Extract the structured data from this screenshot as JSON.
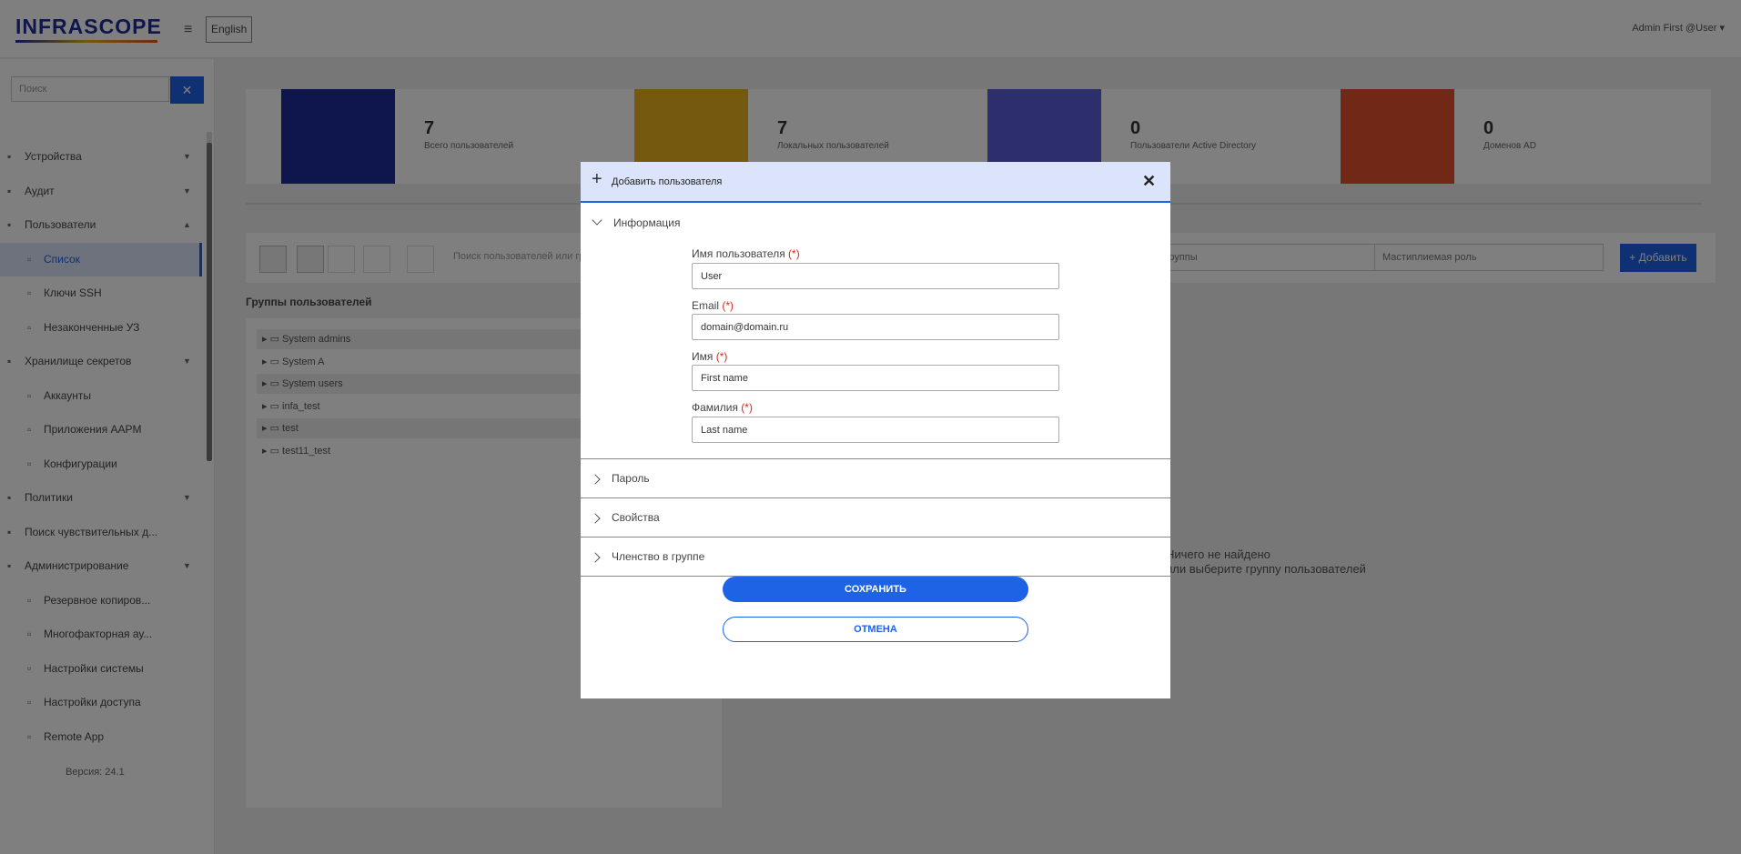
{
  "app": {
    "logo": "INFRASCOPE",
    "language": "English",
    "user_menu": "Admin First @User"
  },
  "sidebar": {
    "search_placeholder": "Поиск",
    "items": [
      {
        "label": "Устройства",
        "icon": "devices-icon",
        "level": 0
      },
      {
        "label": "Аудит",
        "icon": "audit-icon",
        "level": 0
      },
      {
        "label": "Пользователи",
        "icon": "user-icon",
        "level": 0
      },
      {
        "label": "Список",
        "icon": "list-icon",
        "level": 1,
        "active": true
      },
      {
        "label": "Ключи SSH",
        "icon": "key-icon",
        "level": 1
      },
      {
        "label": "Незаконченные УЗ",
        "icon": "pending-icon",
        "level": 1
      },
      {
        "label": "Хранилище секретов",
        "icon": "vault-icon",
        "level": 0
      },
      {
        "label": "Аккаунты",
        "icon": "accounts-icon",
        "level": 1
      },
      {
        "label": "Приложения AAPM",
        "icon": "apps-icon",
        "level": 1
      },
      {
        "label": "Конфигурации",
        "icon": "config-icon",
        "level": 1
      },
      {
        "label": "Политики",
        "icon": "policy-icon",
        "level": 0
      },
      {
        "label": "Поиск чувствительных д...",
        "icon": "search-doc-icon",
        "level": 0
      },
      {
        "label": "Администрирование",
        "icon": "admin-icon",
        "level": 0
      },
      {
        "label": "Резервное копиров...",
        "icon": "backup-icon",
        "level": 1
      },
      {
        "label": "Многофакторная ау...",
        "icon": "mfa-icon",
        "level": 1
      },
      {
        "label": "Настройки системы",
        "icon": "settings-icon",
        "level": 1
      },
      {
        "label": "Настройки доступа",
        "icon": "access-icon",
        "level": 1
      },
      {
        "label": "Remote App",
        "icon": "remote-icon",
        "level": 1
      }
    ],
    "version": "Версия: 24.1"
  },
  "stats": [
    {
      "value": "7",
      "label": "Всего пользователей",
      "color": "#1f2c9c"
    },
    {
      "value": "7",
      "label": "Локальных пользователей",
      "color": "#e8b21c"
    },
    {
      "value": "0",
      "label": "Пользователи Active Directory",
      "color": "#5b5fd9"
    },
    {
      "value": "0",
      "label": "Доменов AD",
      "color": "#e3502c"
    }
  ],
  "toolbar": {
    "search_placeholder": "Поиск пользователей или гр...",
    "filter_groups": "Группы",
    "filter_roles": "Мастиплиемая роль",
    "add_label": "Добавить"
  },
  "groups": {
    "title": "Группы пользователей",
    "items": [
      "System admins",
      "System A",
      "System users",
      "infa_test",
      "test",
      "test11_test"
    ]
  },
  "empty_state": {
    "line1": "Ничего не найдено",
    "line2": "или выберите группу пользователей"
  },
  "modal": {
    "title": "Добавить пользователя",
    "sections": {
      "info": "Информация",
      "password": "Пароль",
      "properties": "Свойства",
      "membership": "Членство в группе"
    },
    "fields": {
      "username": {
        "label": "Имя пользователя",
        "required_mark": "(*)",
        "value": "User"
      },
      "email": {
        "label": "Email",
        "required_mark": "(*)",
        "value": "domain@domain.ru"
      },
      "first_name": {
        "label": "Имя",
        "required_mark": "(*)",
        "value": "First name"
      },
      "last_name": {
        "label": "Фамилия",
        "required_mark": "(*)",
        "value": "Last name"
      }
    },
    "save_label": "СОХРАНИТЬ",
    "cancel_label": "ОТМЕНА"
  },
  "colors": {
    "accent": "#1e62e6",
    "header_bg": "#dbe4fb",
    "required": "#d9261c"
  }
}
